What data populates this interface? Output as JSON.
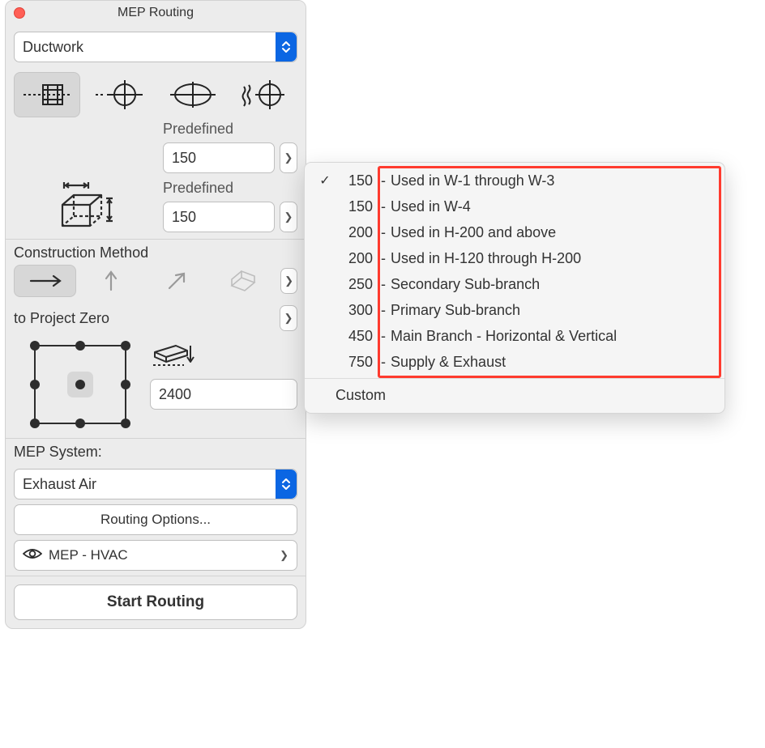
{
  "window": {
    "title": "MEP Routing"
  },
  "category": {
    "selected": "Ductwork"
  },
  "geometry": {
    "selectedIndex": 0
  },
  "size": {
    "label1": "Predefined",
    "value1": "150",
    "label2": "Predefined",
    "value2": "150"
  },
  "construction": {
    "label": "Construction Method",
    "selectedIndex": 0,
    "projectZeroLabel": "to Project Zero",
    "heightValue": "2400"
  },
  "mep": {
    "label": "MEP System:",
    "systemSelected": "Exhaust Air",
    "routingOptionsLabel": "Routing Options...",
    "viewLabel": "MEP - HVAC",
    "startLabel": "Start Routing"
  },
  "dropdown": {
    "items": [
      {
        "value": "150",
        "desc": "Used in W-1 through W-3",
        "checked": true
      },
      {
        "value": "150",
        "desc": "Used in W-4",
        "checked": false
      },
      {
        "value": "200",
        "desc": "Used in H-200 and above",
        "checked": false
      },
      {
        "value": "200",
        "desc": "Used in H-120 through H-200",
        "checked": false
      },
      {
        "value": "250",
        "desc": "Secondary Sub-branch",
        "checked": false
      },
      {
        "value": "300",
        "desc": "Primary Sub-branch",
        "checked": false
      },
      {
        "value": "450",
        "desc": "Main Branch - Horizontal & Vertical",
        "checked": false
      },
      {
        "value": "750",
        "desc": "Supply & Exhaust",
        "checked": false
      }
    ],
    "customLabel": "Custom"
  }
}
